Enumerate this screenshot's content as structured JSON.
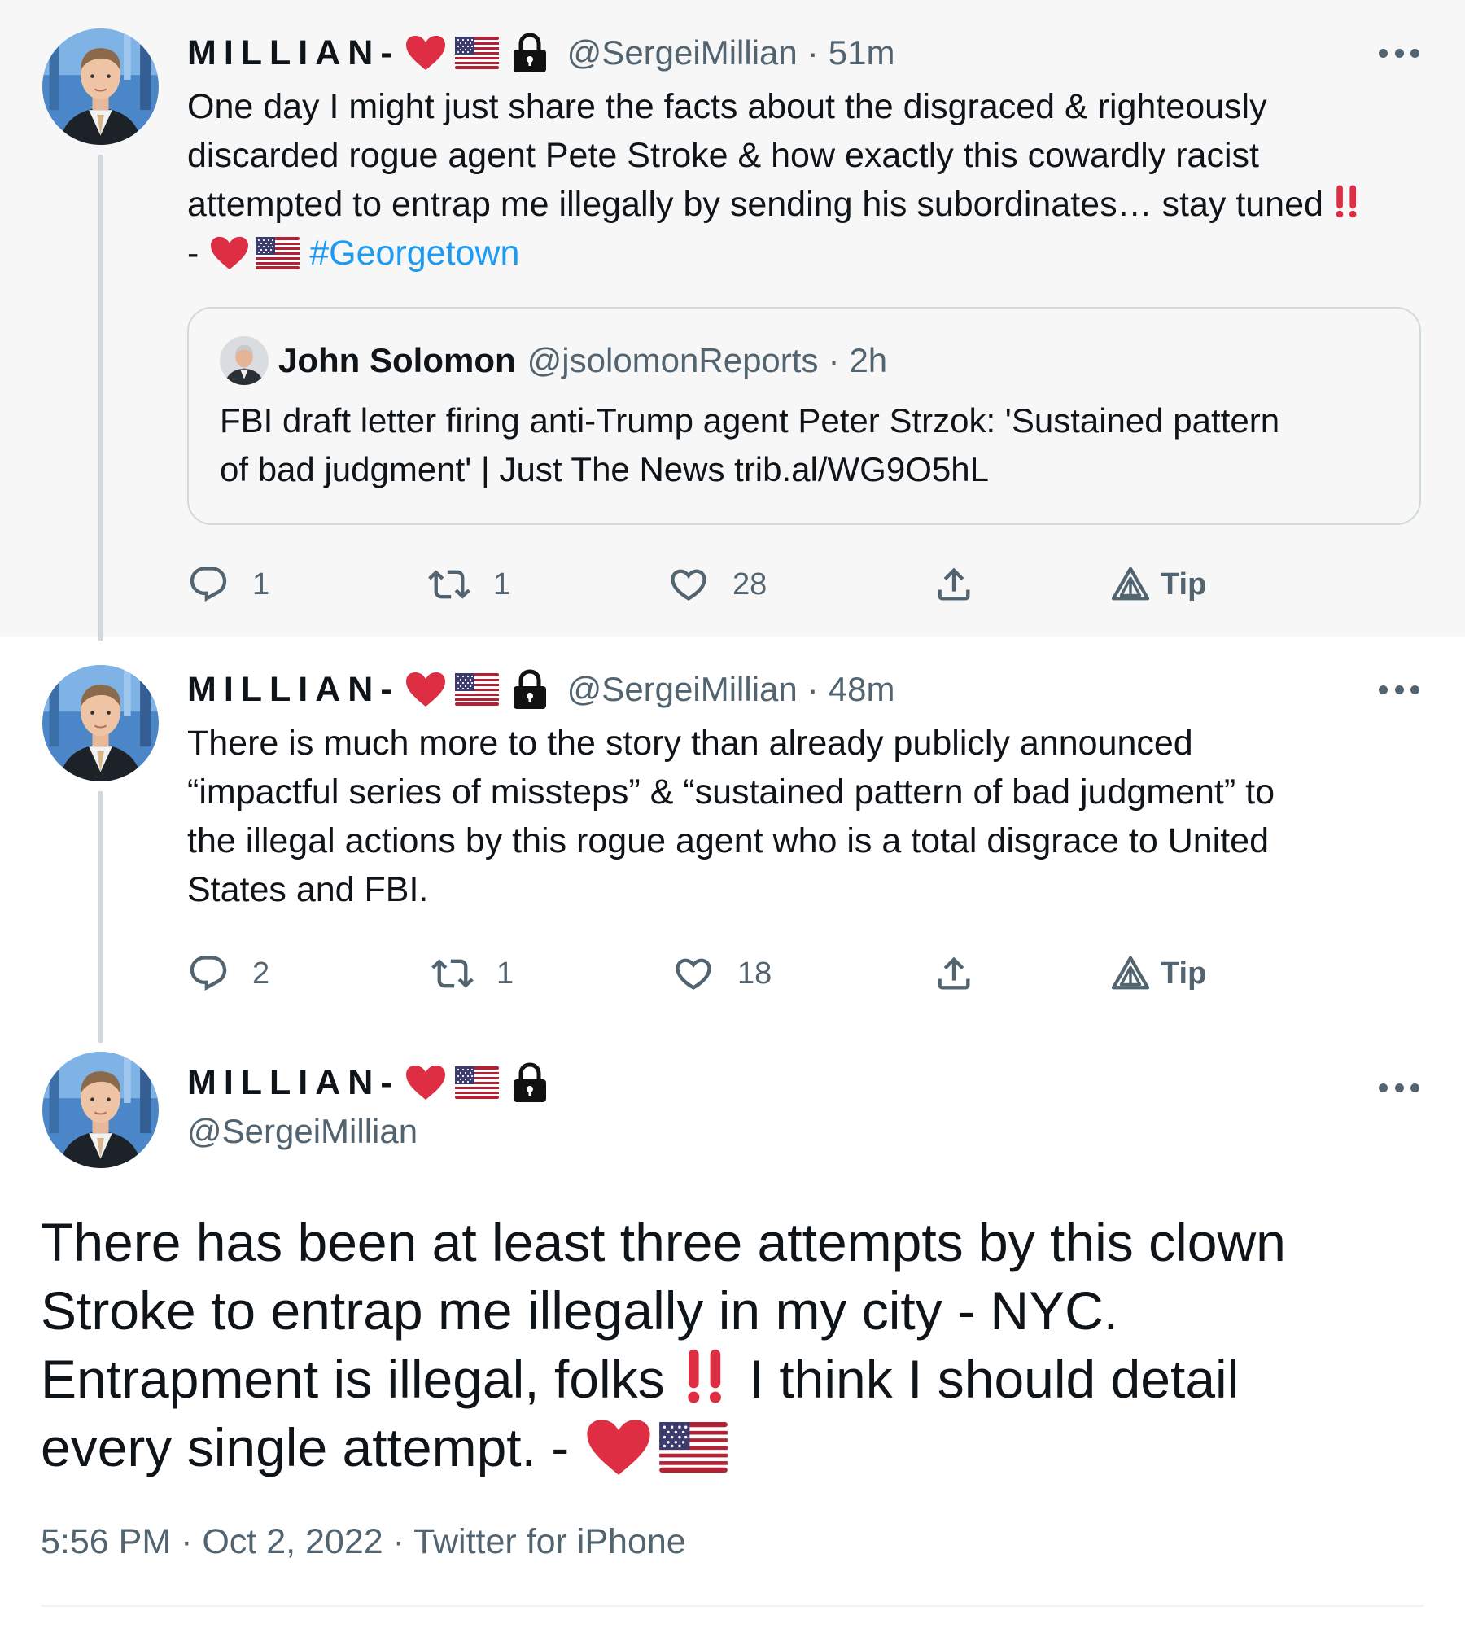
{
  "author": {
    "display_name": "MILLIAN-",
    "handle": "@SergeiMillian"
  },
  "tweet1": {
    "time": "51m",
    "lines": [
      "One day I might just share the facts about the disgraced & righteously",
      "discarded rogue agent Pete Stroke & how exactly this cowardly racist",
      "attempted to entrap me illegally by sending his subordinates… stay tuned"
    ],
    "line4_prefix": "-",
    "hashtag": "#Georgetown",
    "quote": {
      "name": "John Solomon",
      "handle": "@jsolomonReports",
      "time": "2h",
      "lines": [
        "FBI draft letter firing anti-Trump agent Peter Strzok: 'Sustained pattern",
        "of bad judgment' | Just The News trib.al/WG9O5hL"
      ]
    },
    "actions": {
      "replies": "1",
      "retweets": "1",
      "likes": "28",
      "tip": "Tip"
    }
  },
  "tweet2": {
    "time": "48m",
    "lines": [
      "There is much more to the story than already publicly announced",
      "“impactful series of missteps” & “sustained pattern of bad judgment” to",
      "the illegal actions by this rogue agent who is a total disgrace to United",
      "States and FBI."
    ],
    "actions": {
      "replies": "2",
      "retweets": "1",
      "likes": "18",
      "tip": "Tip"
    }
  },
  "tweet3": {
    "lines": [
      "There has been at least three attempts by this clown",
      "Stroke to entrap me illegally in my city - NYC.",
      "Entrapment is illegal, folks",
      "I think I should detail",
      "every single attempt. -"
    ],
    "timestamp": "5:56 PM · Oct 2, 2022 · Twitter for iPhone"
  },
  "separator": "·",
  "icons": [
    "reply-icon",
    "retweet-icon",
    "like-icon",
    "share-icon",
    "tip-icon",
    "more-icon",
    "heart-emoji",
    "us-flag-emoji",
    "lock-emoji",
    "double-exclamation-emoji"
  ],
  "colors": {
    "link": "#1d9bf0",
    "secondary_text": "#536471",
    "emoji_red": "#e0245e"
  }
}
